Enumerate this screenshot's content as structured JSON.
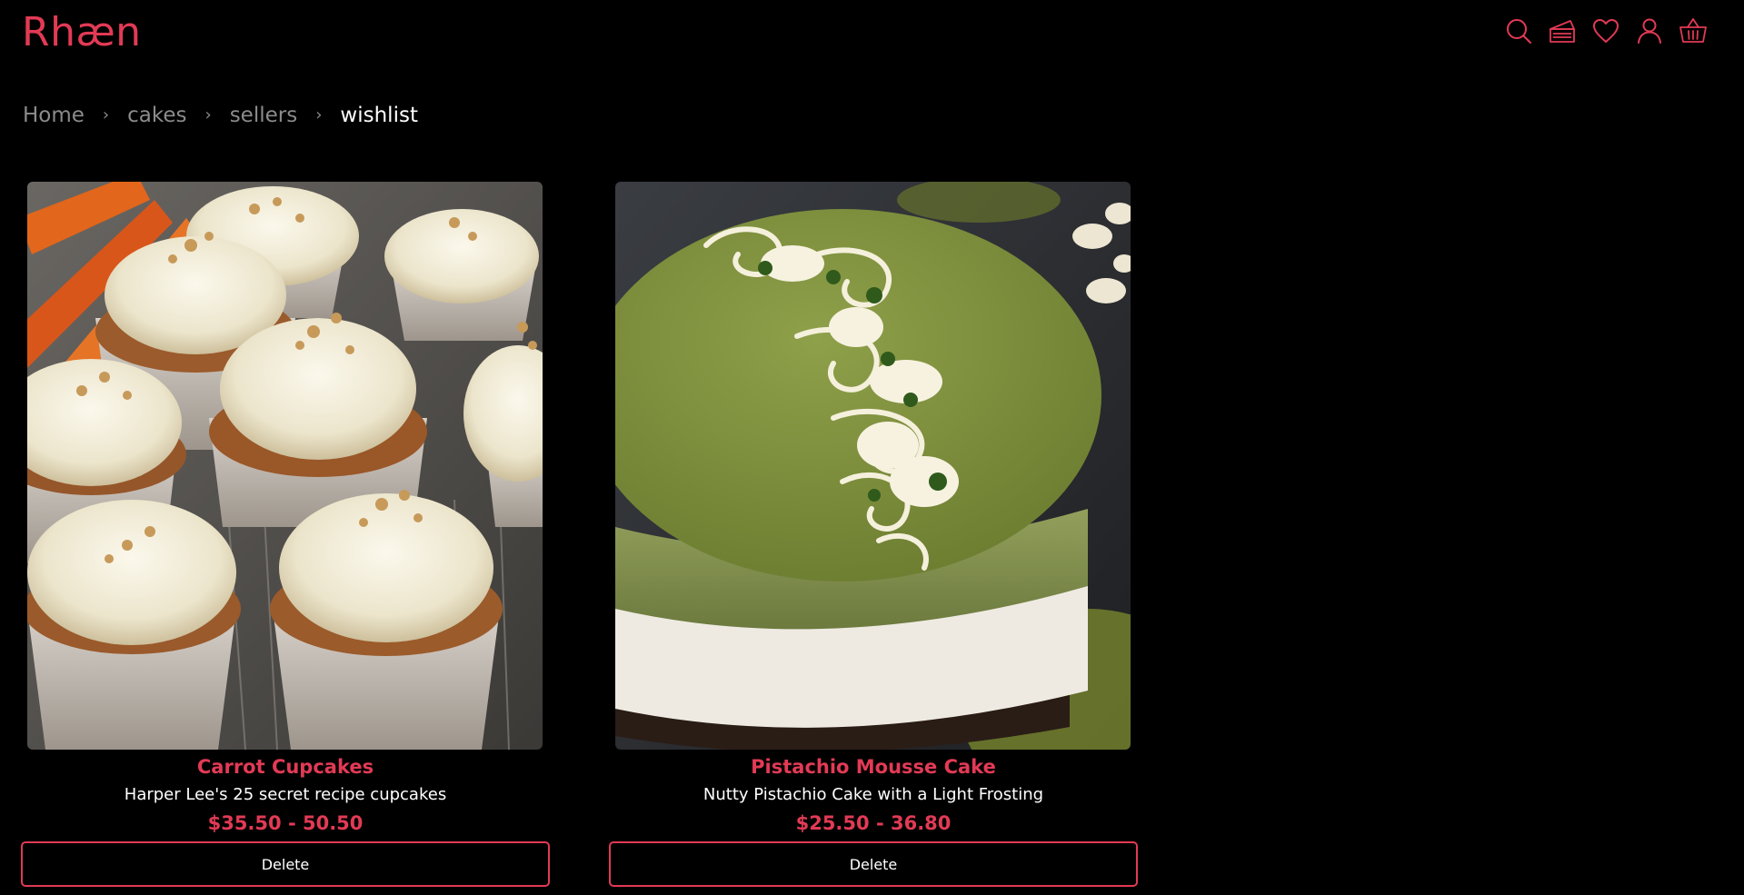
{
  "header": {
    "brand": "Rhæn",
    "icons": [
      "search-icon",
      "cake-icon",
      "heart-icon",
      "user-icon",
      "basket-icon"
    ],
    "accent_color": "#e23a55"
  },
  "breadcrumb": {
    "items": [
      "Home",
      "cakes",
      "sellers",
      "wishlist"
    ],
    "separator": "›"
  },
  "wishlist": {
    "items": [
      {
        "name": "Carrot Cupcakes",
        "description": "Harper Lee's 25 secret recipe cupcakes",
        "price": "$35.50 - 50.50",
        "action_label": "Delete"
      },
      {
        "name": "Pistachio Mousse Cake",
        "description": "Nutty Pistachio Cake with a Light Frosting",
        "price": "$25.50 - 36.80",
        "action_label": "Delete"
      }
    ]
  }
}
